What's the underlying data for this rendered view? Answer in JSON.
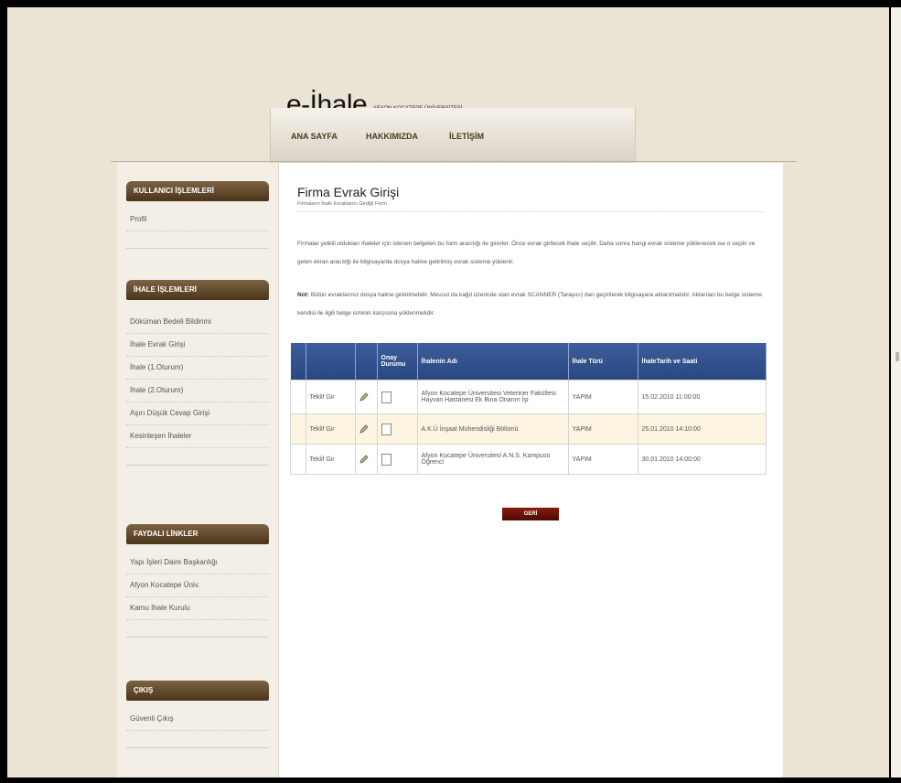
{
  "header": {
    "logo_main": "e-İhale",
    "logo_sub": "AFYON KOCATEPE ÜNİVERSİTESİ",
    "nav": [
      "ANA SAYFA",
      "HAKKIMIZDA",
      "İLETİŞİM"
    ]
  },
  "sidebar": {
    "sections": [
      {
        "title": "KULLANICI İŞLEMLERİ",
        "items": [
          "Profil"
        ]
      },
      {
        "title": "İHALE İŞLEMLERİ",
        "items": [
          "Döküman Bedeli Bildirimi",
          "İhale Evrak Girişi",
          "İhale (1.Oturum)",
          "İhale (2.Oturum)",
          "Aşırı Düşük Cevap Girişi",
          "Kesinleşen İhaleler"
        ]
      },
      {
        "title": "FAYDALI LİNKLER",
        "items": [
          "Yapı İşleri Daire Başkanlığı",
          "Afyon Kocatepe Üniv.",
          "Kamu İhale Kurulu"
        ]
      },
      {
        "title": "ÇIKIŞ",
        "items": [
          "Güvenli Çıkış"
        ]
      }
    ]
  },
  "main": {
    "title": "Firma Evrak Girişi",
    "subtitle": "Firmaların İhale Evraklarını Girdiği Form",
    "intro": "Firmalar yetkili oldukları ihaleler için istenen belgeleri bu form aracılığı ile girerler. Önce evrak girilecek ihale seçilir. Daha sonra hangi evrak sisteme yüklenecek ise o seçilir ve gelen ekran aracılığı ile bilgisayarda dosya haline getirilmiş evrak sisteme yüklenir.",
    "note_label": "Not:",
    "note_text": "Bütün evraklarınız dosya haline getirilmelidir. Mevcut da kağıt üzerinde olan evrak SCANNER (Tarayıcı) dan geçirilerek bilgisayara aktarılmalıdır. Aktarılan bu belge sisteme kendisi ile ilgili belge isminin karşısına yüklenmelidir.",
    "table": {
      "headers": [
        "",
        "",
        "",
        "Onay Durumu",
        "İhalenin Adı",
        "İhale Türü",
        "İhaleTarih ve Saati"
      ],
      "rows": [
        {
          "link": "Teklif Gir",
          "name": "Afyon Kocatepe Üniversitesi Veteriner Fakültesi Hayvan Hastanesi Ek Bina Onarım İşi",
          "type": "YAPIM",
          "date": "15.02.2010 11:00:00"
        },
        {
          "link": "Teklif Gir",
          "name": "A.K.Ü İnşaat Mühendisliği Bölümü",
          "type": "YAPIM",
          "date": "25.01.2010 14:10:00"
        },
        {
          "link": "Teklif Gir",
          "name": "Afyon Kocatepe Üniversitesi A.N.S. Kampusü Öğrenci",
          "type": "YAPIM",
          "date": "30.01.2010 14:00:00"
        }
      ]
    },
    "back_button": "GERİ"
  },
  "colors": {
    "sidebar_header": "#5a4426",
    "table_header": "#2f4e8a",
    "highlight_row": "#fdf4e1",
    "back_button": "#6b1206"
  }
}
